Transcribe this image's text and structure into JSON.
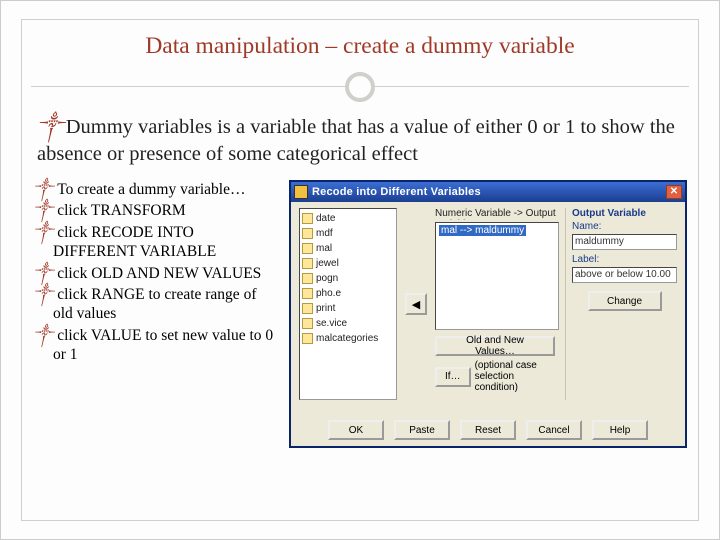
{
  "slide": {
    "title": "Data manipulation – create a dummy variable",
    "intro_lead_glyph": "༒",
    "intro": "Dummy variables is a variable that has a value of either 0 or 1 to show the absence or presence of some categorical effect"
  },
  "steps": [
    "To create a dummy variable…",
    "click TRANSFORM",
    "click RECODE INTO DIFFERENT VARIABLE",
    "click OLD AND NEW VALUES",
    "click RANGE to create range of old values",
    "click VALUE to set new value to 0 or 1"
  ],
  "step_glyph": "༒",
  "dialog": {
    "title": "Recode into Different Variables",
    "close_glyph": "✕",
    "mid_label": "Numeric Variable -> Output Variable:",
    "target_selection": "mal --> maldummy",
    "arrow_glyph": "◀",
    "old_new_button": "Old and New Values…",
    "if_button": "If…",
    "if_caption": "(optional case selection condition)",
    "output_section_label": "Output Variable",
    "name_label": "Name:",
    "name_value": "maldummy",
    "label_label": "Label:",
    "label_value": "above or below 10.00",
    "change_button": "Change",
    "variables": [
      "date",
      "mdf",
      "mal",
      "jewel",
      "pogn",
      "pho.e",
      "print",
      "se.vice",
      "malcategories"
    ],
    "buttons": {
      "ok": "OK",
      "paste": "Paste",
      "reset": "Reset",
      "cancel": "Cancel",
      "help": "Help"
    }
  }
}
